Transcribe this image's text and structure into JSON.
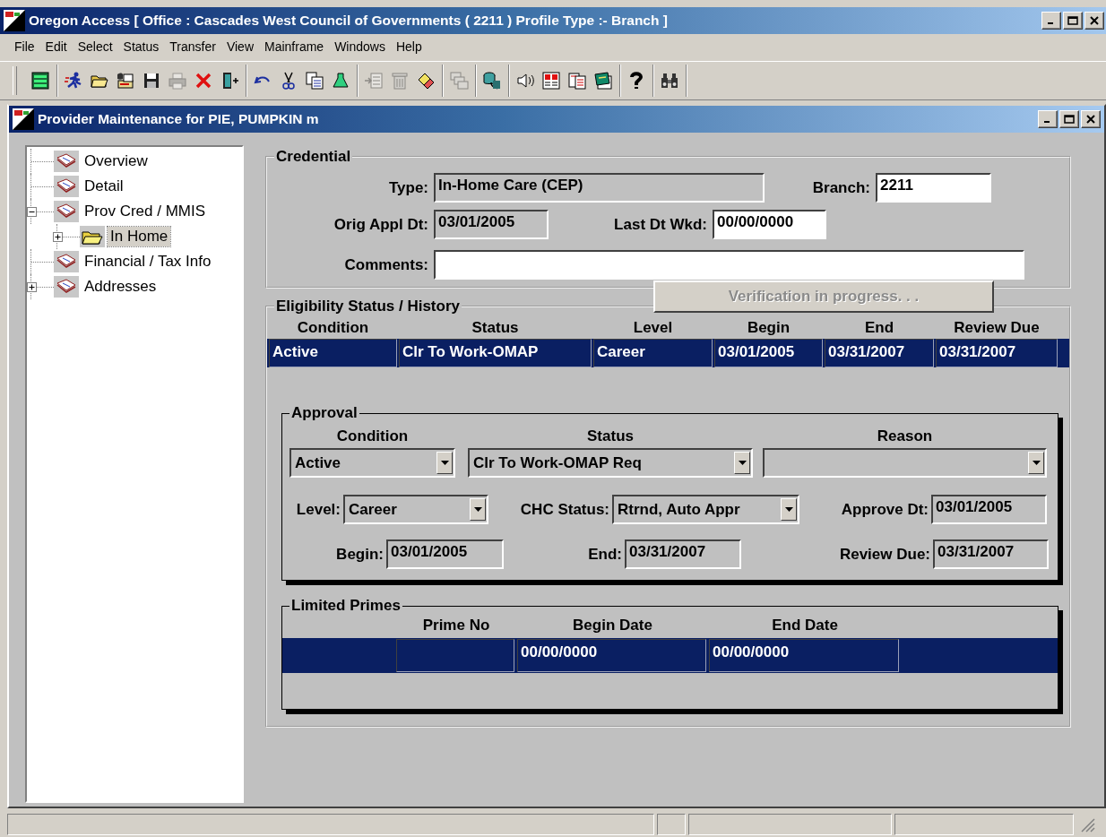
{
  "window": {
    "title": "Oregon Access [ Office : Cascades West Council of Governments ( 2211 ) Profile Type :- Branch ]"
  },
  "menu": [
    "File",
    "Edit",
    "Select",
    "Status",
    "Transfer",
    "View",
    "Mainframe",
    "Windows",
    "Help"
  ],
  "toolbar": {
    "groups": [
      [
        {
          "disabled": false
        }
      ],
      [
        {
          "disabled": false
        },
        {
          "disabled": false
        },
        {
          "disabled": false
        },
        {
          "disabled": false
        },
        {
          "disabled": true
        },
        {
          "disabled": false
        },
        {
          "disabled": false
        }
      ],
      [
        {
          "disabled": false
        },
        {
          "disabled": false
        },
        {
          "disabled": false
        },
        {
          "disabled": false
        }
      ],
      [
        {
          "disabled": true
        },
        {
          "disabled": true
        },
        {
          "disabled": false
        }
      ],
      [
        {
          "disabled": true
        }
      ],
      [
        {
          "disabled": false
        }
      ],
      [
        {
          "disabled": false
        },
        {
          "disabled": false
        },
        {
          "disabled": false
        },
        {
          "disabled": false
        }
      ],
      [
        {
          "disabled": false
        }
      ],
      [
        {
          "disabled": false
        }
      ]
    ]
  },
  "child_window": {
    "title": "Provider Maintenance for PIE, PUMPKIN m"
  },
  "tree": {
    "items": [
      {
        "label": "Overview",
        "kind": "book",
        "selected": false
      },
      {
        "label": "Detail",
        "kind": "book",
        "selected": false
      },
      {
        "label": "Prov Cred / MMIS",
        "kind": "book",
        "selected": false,
        "expanded": true,
        "children": [
          {
            "label": "In Home",
            "kind": "folder",
            "selected": true,
            "expanded": false
          }
        ]
      },
      {
        "label": "Financial / Tax Info",
        "kind": "book",
        "selected": false
      },
      {
        "label": "Addresses",
        "kind": "book",
        "selected": false,
        "expanded": false
      }
    ]
  },
  "credential": {
    "title": "Credential",
    "fields": [
      {
        "label": "Type:",
        "value": "In-Home Care (CEP)",
        "read_only": true
      },
      {
        "label": "Branch:",
        "value": "2211",
        "read_only": false
      },
      {
        "label": "Orig Appl Dt:",
        "value": "03/01/2005",
        "read_only": true
      },
      {
        "label": "Last Dt Wkd:",
        "value": "00/00/0000",
        "read_only": false
      },
      {
        "label": "Comments:",
        "read_only": false
      }
    ]
  },
  "verify_button": {
    "label": "Verification in progress. . .",
    "disabled": true
  },
  "eligibility": {
    "title": "Eligibility Status / History",
    "columns": [
      "Condition",
      "Status",
      "Level",
      "Begin",
      "End",
      "Review Due"
    ],
    "rows": [
      {
        "cells": [
          "Active",
          "Clr To Work-OMAP",
          "Career",
          "03/01/2005",
          "03/31/2007",
          "03/31/2007"
        ],
        "selected": true
      }
    ]
  },
  "approval": {
    "title": "Approval",
    "dropdowns": [
      {
        "header": "Condition",
        "value": "Active"
      },
      {
        "header": "Status",
        "value": "Clr To Work-OMAP Req"
      },
      {
        "header": "Reason"
      }
    ],
    "rows": [
      [
        {
          "kind": "dropdown",
          "label": "Level:",
          "value": "Career"
        },
        {
          "kind": "dropdown",
          "label": "CHC Status:",
          "value": "Rtrnd, Auto Appr"
        },
        {
          "kind": "field",
          "label": "Approve Dt:",
          "value": "03/01/2005"
        }
      ],
      [
        {
          "kind": "field",
          "label": "Begin:",
          "value": "03/01/2005"
        },
        {
          "kind": "field",
          "label": "End:",
          "value": "03/31/2007"
        },
        {
          "kind": "field",
          "label": "Review Due:",
          "value": "03/31/2007"
        }
      ]
    ]
  },
  "limited_primes": {
    "title": "Limited Primes",
    "columns": [
      "Prime No",
      "Begin Date",
      "End Date"
    ],
    "rows": [
      {
        "cells": [
          {},
          {
            "value": "00/00/0000"
          },
          {
            "value": "00/00/0000"
          }
        ],
        "selected": true
      }
    ]
  }
}
